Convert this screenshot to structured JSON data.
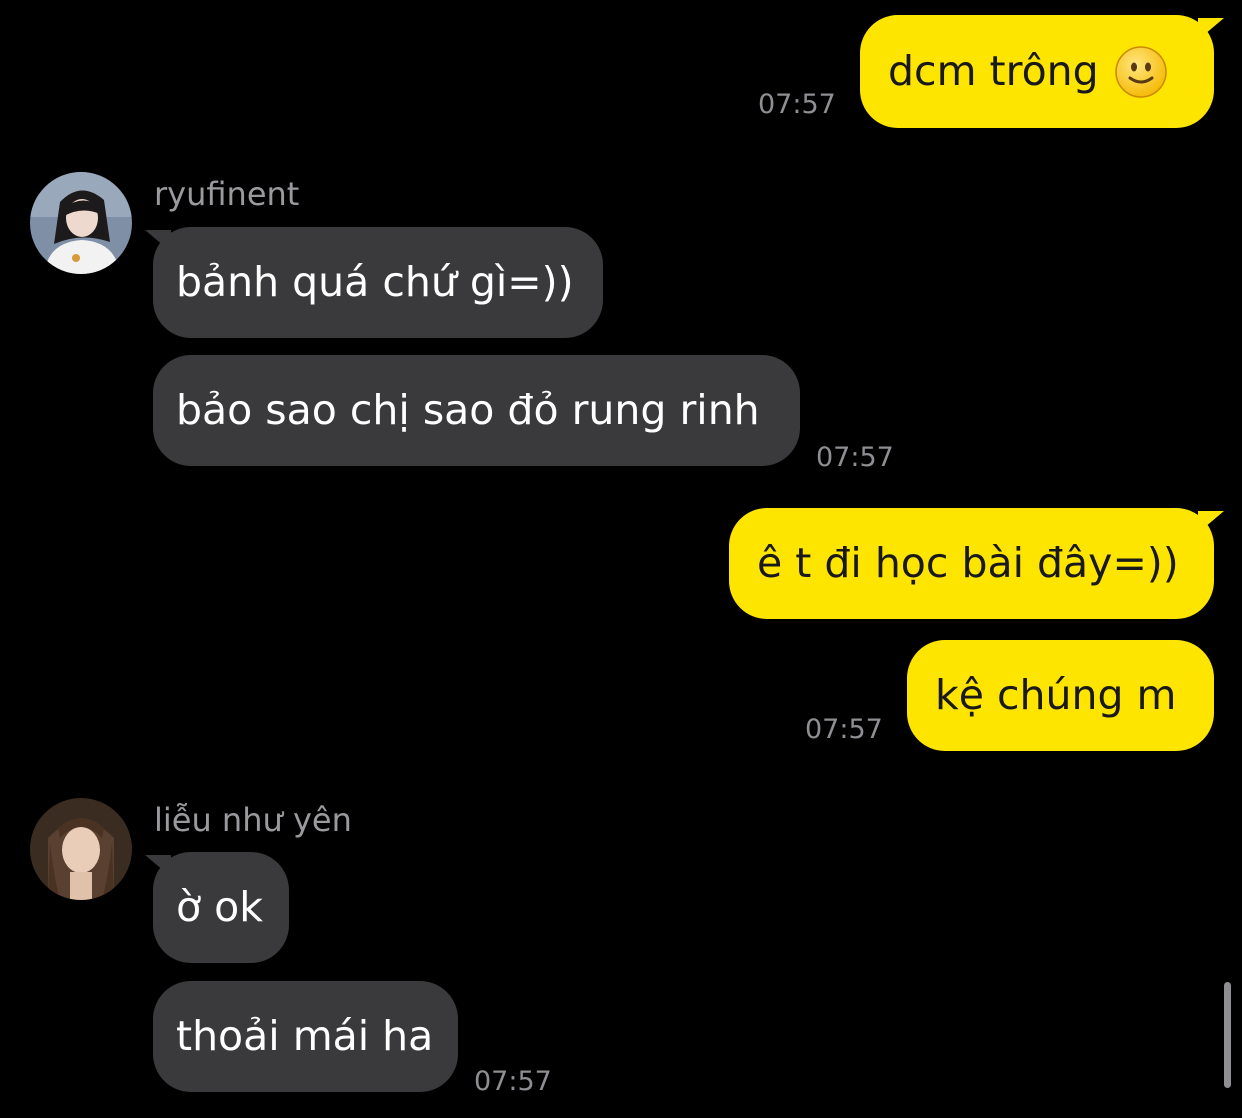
{
  "messages": [
    {
      "text": "dcm trông",
      "emoji": "slightly-smiling-face",
      "time": "07:57"
    },
    {
      "sender": "ryufinent",
      "text": "bảnh quá chứ gì=))"
    },
    {
      "text": "bảo sao chị sao đỏ rung rinh",
      "time": "07:57"
    },
    {
      "text": "ê t đi học bài đây=))"
    },
    {
      "text": "kệ chúng m",
      "time": "07:57"
    },
    {
      "sender": "liễu như yên",
      "text": "ờ ok"
    },
    {
      "text": "thoải mái ha",
      "time": "07:57"
    }
  ],
  "colors": {
    "background": "#000000",
    "outgoing_bubble": "#fee500",
    "outgoing_text": "#191919",
    "incoming_bubble": "#3a3a3c",
    "incoming_text": "#ffffff",
    "meta_text": "#8e8e93"
  }
}
